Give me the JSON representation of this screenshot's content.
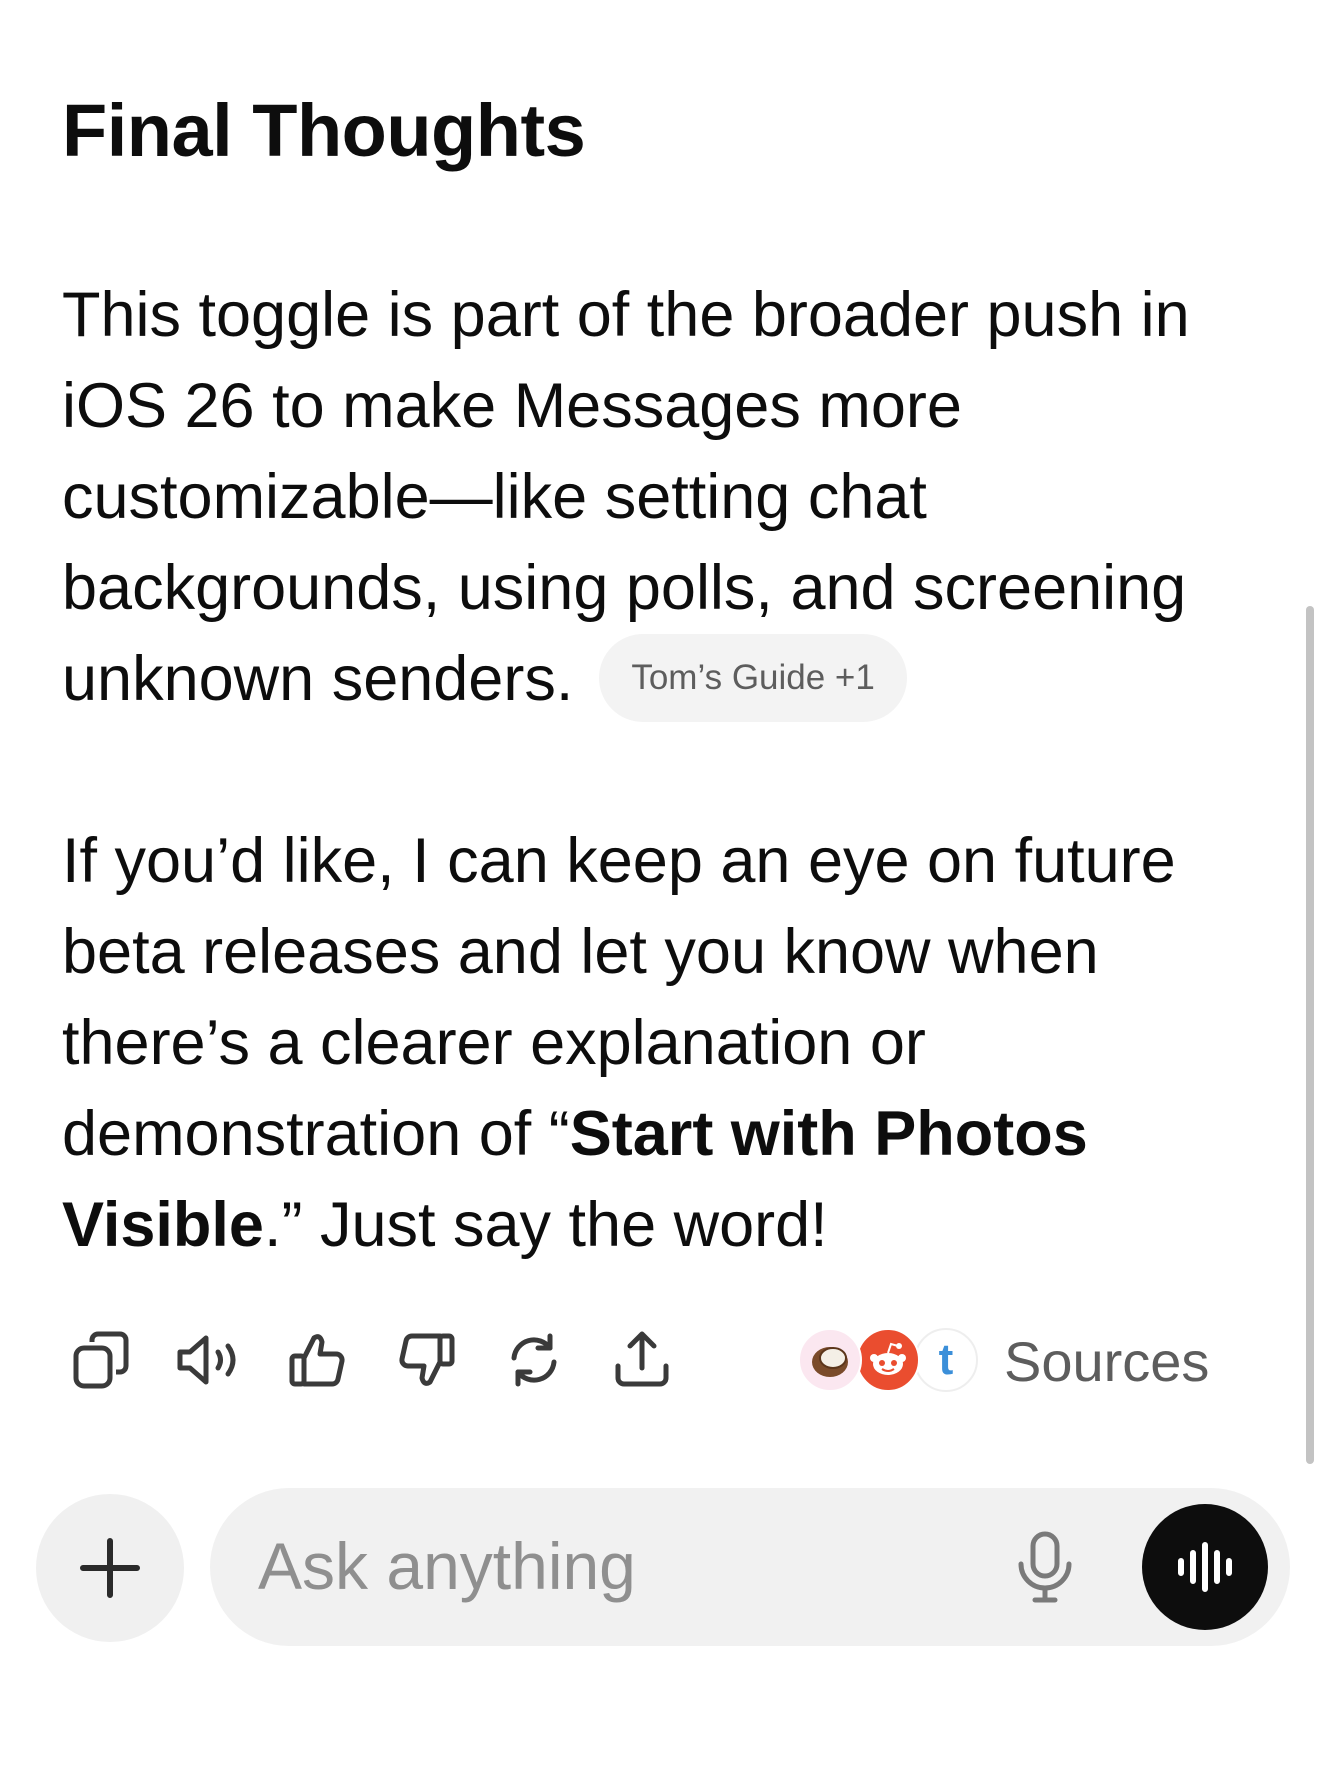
{
  "message": {
    "heading": "Final Thoughts",
    "para1_text": "This toggle is part of the broader push in iOS 26 to make Messages more customizable—like setting chat backgrounds, using polls, and screening unknown senders.",
    "citation_label": "Tom’s Guide +1",
    "para2_before": "If you’d like, I can keep an eye on future beta releases and let you know when there’s a clearer explanation or demonstration of “",
    "para2_bold": "Start with Photos Visible",
    "para2_after": ".” Just say the word!"
  },
  "actions": {
    "icons": [
      "copy-icon",
      "read-aloud-icon",
      "thumbs-up-icon",
      "thumbs-down-icon",
      "regenerate-icon",
      "share-icon"
    ],
    "sources_label": "Sources",
    "source_avatars": [
      "coconut-avatar",
      "reddit-avatar",
      "tumblr-avatar"
    ],
    "tumblr_letter": "t"
  },
  "composer": {
    "placeholder": "Ask anything",
    "icons": [
      "plus-icon",
      "microphone-icon",
      "voice-mode-icon"
    ]
  },
  "colors": {
    "text": "#0d0d0d",
    "muted": "#5d5d5d",
    "pill_bg": "#f3f3f3",
    "composer_bg": "#f1f1f1",
    "reddit": "#ea4d2f",
    "tumblr": "#3b8fd9",
    "voice_btn": "#0d0d0d"
  }
}
